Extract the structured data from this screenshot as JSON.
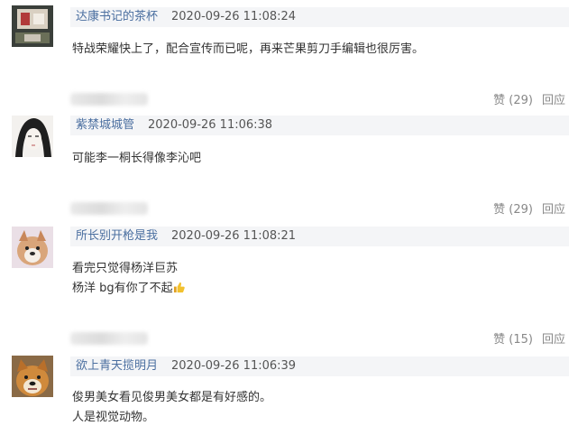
{
  "comments": [
    {
      "username": "达康书记的茶杯",
      "timestamp": "2020-09-26 11:08:24",
      "lines": [
        "特战荣耀快上了，配合宣传而已呢，再来芒果剪刀手编辑也很厉害。"
      ],
      "like_label": "赞 (29)",
      "reply_label": "回应",
      "avatar_icon": "avatar-image"
    },
    {
      "username": "紫禁城城管",
      "timestamp": "2020-09-26 11:06:38",
      "lines": [
        "可能李一桐长得像李沁吧"
      ],
      "like_label": "赞 (29)",
      "reply_label": "回应",
      "avatar_icon": "avatar-sketch-portrait"
    },
    {
      "username": "所长别开枪是我",
      "timestamp": "2020-09-26 11:08:21",
      "lines": [
        "看完只觉得杨洋巨苏",
        "杨洋 bg有你了不起"
      ],
      "line2_emoji": "thumbs-up-icon",
      "like_label": "赞 (15)",
      "reply_label": "回应",
      "avatar_icon": "avatar-dog"
    },
    {
      "username": "欲上青天揽明月",
      "timestamp": "2020-09-26 11:06:39",
      "lines": [
        "俊男美女看见俊男美女都是有好感的。",
        "人是视觉动物。"
      ],
      "avatar_icon": "avatar-shiba-dog"
    }
  ],
  "colors": {
    "username": "#4b6fa0",
    "meta_bar_bg": "#f4f5f7",
    "text": "#333333",
    "muted": "#888888"
  }
}
